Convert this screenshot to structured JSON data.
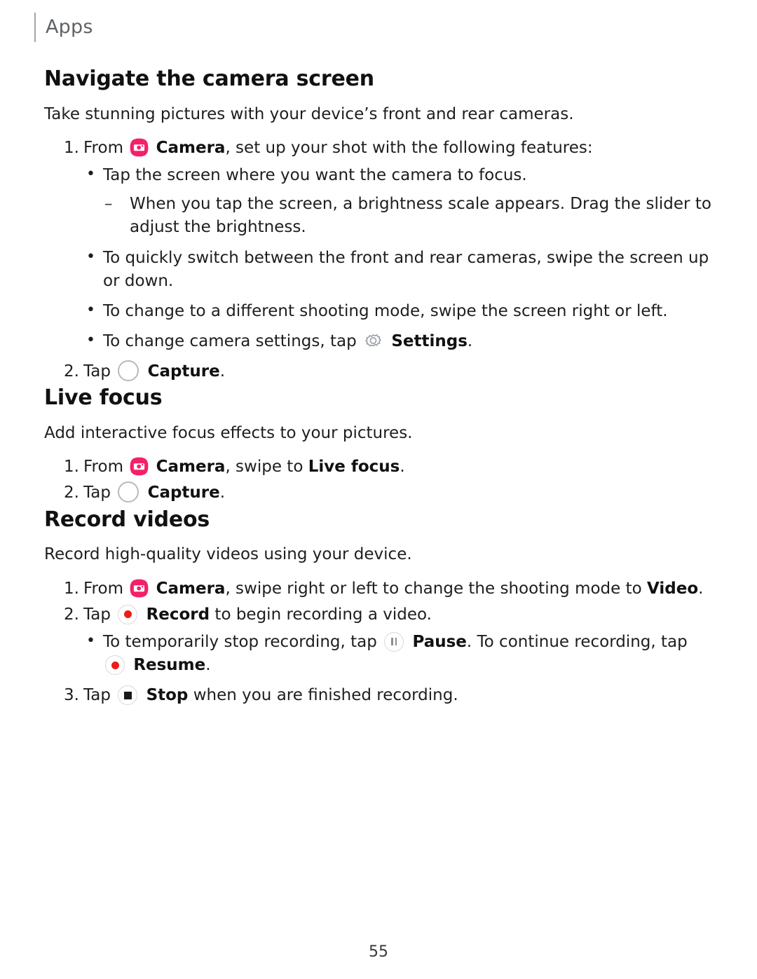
{
  "header": {
    "title": "Apps"
  },
  "sections": [
    {
      "id": "navigate-camera-screen",
      "title": "Navigate the camera screen",
      "lead": "Take stunning pictures with your device’s front and rear cameras.",
      "steps": [
        {
          "number": "1.",
          "pre": "From",
          "icon": "camera-icon",
          "bold": "Camera",
          "post": ", set up your shot with the following features:",
          "bullets": [
            {
              "text": "Tap the screen where you want the camera to focus.",
              "dashes": [
                "When you tap the screen, a brightness scale appears. Drag the slider to adjust the brightness."
              ]
            },
            {
              "text": "To quickly switch between the front and rear cameras, swipe the screen up or down."
            },
            {
              "text": "To change to a different shooting mode, swipe the screen right or left."
            },
            {
              "pre": "To change camera settings, tap",
              "icon": "gear-icon",
              "bold": "Settings",
              "post": "."
            }
          ]
        },
        {
          "number": "2.",
          "pre": "Tap",
          "icon": "capture-icon",
          "bold": "Capture",
          "post": "."
        }
      ]
    },
    {
      "id": "live-focus",
      "title": "Live focus",
      "lead": "Add interactive focus effects to your pictures.",
      "steps": [
        {
          "number": "1.",
          "pre": "From",
          "icon": "camera-icon",
          "bold": "Camera",
          "mid": ", swipe to ",
          "bold2": "Live focus",
          "post": "."
        },
        {
          "number": "2.",
          "pre": "Tap",
          "icon": "capture-icon",
          "bold": "Capture",
          "post": "."
        }
      ]
    },
    {
      "id": "record-videos",
      "title": "Record videos",
      "lead": "Record high-quality videos using your device.",
      "steps": [
        {
          "number": "1.",
          "pre": "From",
          "icon": "camera-icon",
          "bold": "Camera",
          "mid": ", swipe right or left to change the shooting mode to ",
          "bold2": "Video",
          "post": "."
        },
        {
          "number": "2.",
          "pre": "Tap",
          "icon": "record-icon",
          "bold": "Record",
          "post": " to begin recording a video.",
          "bullets": [
            {
              "pre": "To temporarily stop recording, tap",
              "icon": "pause-icon",
              "bold": "Pause",
              "mid": ". To continue recording, tap",
              "icon2": "resume-icon",
              "bold2": "Resume",
              "post": "."
            }
          ]
        },
        {
          "number": "3.",
          "pre": "Tap",
          "icon": "stop-icon",
          "bold": "Stop",
          "post": " when you are finished recording."
        }
      ]
    }
  ],
  "footer": {
    "page_number": "55"
  },
  "colors": {
    "camera_pink": "#F4206A",
    "record_red": "#EE1C16",
    "icon_gray": "#8C9096",
    "ring_gray": "#D8D8D8",
    "header_gray": "#5F6366"
  }
}
